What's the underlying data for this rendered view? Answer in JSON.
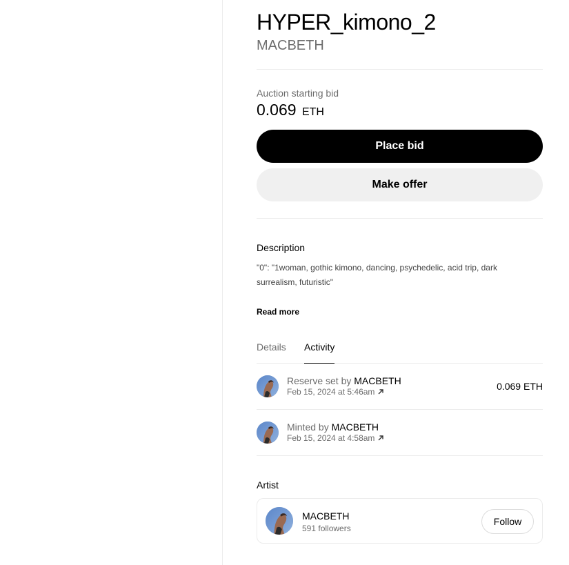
{
  "artwork": {
    "title": "HYPER_kimono_2",
    "creator": "MACBETH"
  },
  "auction": {
    "label": "Auction starting bid",
    "amount": "0.069",
    "currency": "ETH",
    "place_bid_label": "Place bid",
    "make_offer_label": "Make offer"
  },
  "description": {
    "heading": "Description",
    "text": "\"0\": \"1woman, gothic kimono, dancing, psychedelic, acid trip, dark surrealism, futuristic\"",
    "read_more_label": "Read more"
  },
  "tabs": [
    {
      "label": "Details",
      "active": false
    },
    {
      "label": "Activity",
      "active": true
    }
  ],
  "activity": [
    {
      "action": "Reserve set by",
      "user": "MACBETH",
      "date": "Feb 15, 2024 at 5:46am",
      "price": "0.069 ETH",
      "link_icon": "arrow-up-right-icon"
    },
    {
      "action": "Minted by",
      "user": "MACBETH",
      "date": "Feb 15, 2024 at 4:58am",
      "price": "",
      "link_icon": "arrow-up-right-icon"
    }
  ],
  "artist": {
    "heading": "Artist",
    "name": "MACBETH",
    "followers": "591 followers",
    "follow_label": "Follow"
  },
  "colors": {
    "primary_button": "#000000",
    "secondary_button": "#f0f0f0",
    "muted_text": "#6b6b6b",
    "divider": "#ebebeb"
  }
}
